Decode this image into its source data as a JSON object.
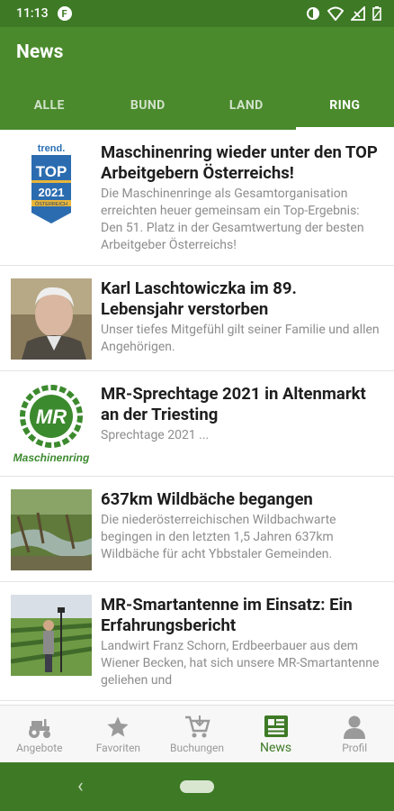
{
  "status_bar": {
    "time": "11:13",
    "app_icon_letter": "F"
  },
  "app_bar": {
    "title": "News"
  },
  "tabs": [
    {
      "label": "ALLE",
      "active": false
    },
    {
      "label": "BUND",
      "active": false
    },
    {
      "label": "LAND",
      "active": false
    },
    {
      "label": "RING",
      "active": true
    }
  ],
  "news": [
    {
      "title": "Maschinenring wieder unter den TOP Arbeitgebern Österreichs!",
      "desc": "Die Maschinenringe als Gesamtorganisation erreichten heuer gemeinsam ein Top-Ergebnis: Den 51. Platz in der Gesamtwertung der besten Arbeitgeber Österreichs!",
      "badge": {
        "brand": "trend.",
        "top": "TOP",
        "year": "2021",
        "country": "ÖSTERREICH"
      }
    },
    {
      "title": "Karl Laschtowiczka im 89. Lebensjahr verstorben",
      "desc": "Unser tiefes Mitgefühl gilt seiner Familie und allen Angehörigen."
    },
    {
      "title": "MR-Sprechtage 2021 in Altenmarkt an der Triesting",
      "desc": "Sprechtage 2021 ...",
      "logo": {
        "initials": "MR",
        "caption": "Maschinenring"
      }
    },
    {
      "title": "637km Wildbäche begangen",
      "desc": "Die niederösterreichischen Wildbachwarte begingen in den letzten 1,5 Jahren 637km Wildbäche für acht Ybbstaler Gemeinden."
    },
    {
      "title": "MR-Smartantenne im Einsatz: Ein Erfahrungsbericht",
      "desc": "Landwirt Franz Schorn, Erdbeerbauer aus dem Wiener Becken, hat sich unsere MR-Smartantenne geliehen und"
    }
  ],
  "bottom_nav": [
    {
      "label": "Angebote",
      "icon": "tractor-icon",
      "active": false
    },
    {
      "label": "Favoriten",
      "icon": "star-icon",
      "active": false
    },
    {
      "label": "Buchungen",
      "icon": "cart-icon",
      "active": false
    },
    {
      "label": "News",
      "icon": "news-icon",
      "active": true
    },
    {
      "label": "Profil",
      "icon": "person-icon",
      "active": false
    }
  ],
  "colors": {
    "primary": "#4a8a2c",
    "primary_dark": "#3e7a26",
    "inactive": "#9a9a9a",
    "desc_text": "#8d8d8d"
  }
}
